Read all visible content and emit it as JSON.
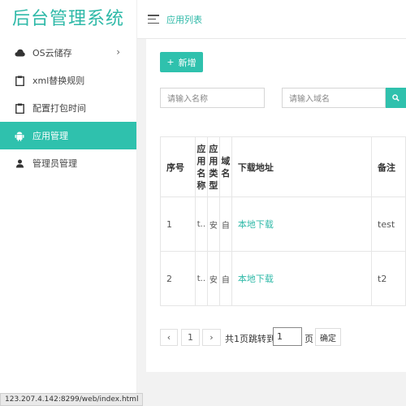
{
  "app": {
    "title": "后台管理系统"
  },
  "header": {
    "title": "应用列表"
  },
  "sidebar": {
    "items": [
      {
        "label": "OS云储存",
        "icon": "cloud-icon",
        "arrow": "›"
      },
      {
        "label": "xml替换规则",
        "icon": "clipboard-icon"
      },
      {
        "label": "配置打包时间",
        "icon": "clipboard-icon"
      },
      {
        "label": "应用管理",
        "icon": "android-icon",
        "active": true
      },
      {
        "label": "管理员管理",
        "icon": "user-icon"
      }
    ]
  },
  "toolbar": {
    "add_plus": "+",
    "add_label": "新增"
  },
  "search": {
    "name_placeholder": "请输入名称",
    "domain_placeholder": "请输入域名"
  },
  "table": {
    "headers": {
      "no": "序号",
      "app_name": "应用名称",
      "app_type": "应用类型",
      "domain": "域名",
      "download": "下载地址",
      "note": "备注"
    },
    "rows": [
      {
        "no": "1",
        "app_name": "t..",
        "app_type": "安",
        "domain": "自",
        "download": "本地下载",
        "note": "test"
      },
      {
        "no": "2",
        "app_name": "t..",
        "app_type": "安",
        "domain": "自",
        "download": "本地下载",
        "note": "t2"
      }
    ]
  },
  "pagination": {
    "prev": "‹",
    "current": "1",
    "next": "›",
    "total_text": "共1页跳转到",
    "jump_value": "1",
    "page_suffix": "页",
    "confirm": "确定"
  },
  "status_bar": {
    "url": "123.207.4.142:8299/web/index.html"
  },
  "colors": {
    "accent": "#2fc1ad",
    "accent_text": "#2fb9a8"
  }
}
